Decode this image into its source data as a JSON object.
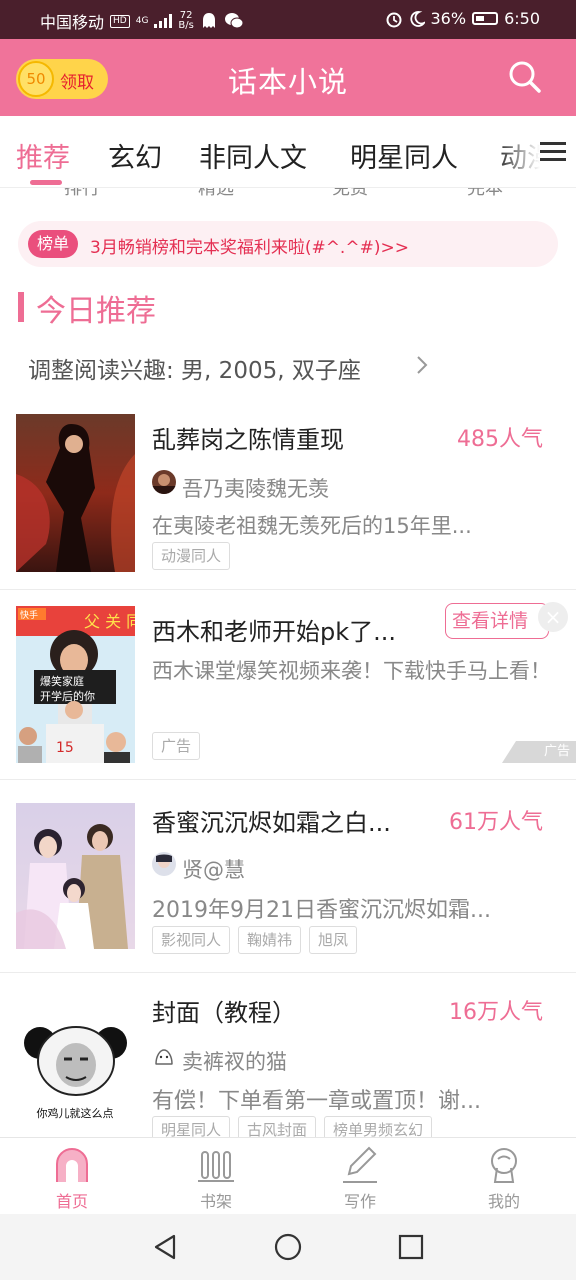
{
  "status_bar": {
    "carrier": "中国移动",
    "hd": "HD",
    "network": "4G",
    "net_speed_value": "72",
    "net_speed_unit": "B/s",
    "battery": "36%",
    "time": "6:50"
  },
  "header": {
    "coin_amount": "50",
    "coin_label": "领取",
    "title": "话本小说",
    "search_icon": "search-icon",
    "brand_color": "#f0739a"
  },
  "tabs": [
    {
      "label": "推荐",
      "active": true
    },
    {
      "label": "玄幻",
      "active": false
    },
    {
      "label": "非同人文",
      "active": false
    },
    {
      "label": "明星同人",
      "active": false
    },
    {
      "label": "动漫",
      "active": false
    }
  ],
  "quick_links": [
    "排行",
    "精选",
    "免费",
    "完本"
  ],
  "notice": {
    "badge": "榜单",
    "text": "3月畅销榜和完本奖福利来啦(#^.^#)>>"
  },
  "section": {
    "title": "今日推荐",
    "interest": "调整阅读兴趣: 男, 2005, 双子座"
  },
  "items": [
    {
      "title": "乱葬岗之陈情重现",
      "popularity": "485人气",
      "author": "吾乃夷陵魏无羡",
      "description": "在夷陵老祖魏无羡死后的15年里...",
      "tags": [
        "动漫同人"
      ]
    },
    {
      "title": "西木和老师开始pk了...",
      "ad_button": "查看详情",
      "description": "西木课堂爆笑视频来袭！下载快手马上看！",
      "tags": [
        "广告"
      ],
      "ad_corner": "广告",
      "cover_brand": "快手",
      "cover_caption": "爆笑家庭 开学后的你",
      "cover_top_text": "父 关 同",
      "cover_jersey": "15"
    },
    {
      "title": "香蜜沉沉烬如霜之白...",
      "popularity": "61万人气",
      "author": "贤@慧",
      "description": "2019年9月21日香蜜沉沉烬如霜...",
      "tags": [
        "影视同人",
        "鞠婧祎",
        "旭凤"
      ]
    },
    {
      "title": "封面（教程）",
      "popularity": "16万人气",
      "author": "卖裤衩的猫",
      "description": "有偿！下单看第一章或置顶！谢...",
      "tags": [
        "明星同人",
        "古风封面",
        "榜单男频玄幻"
      ],
      "cover_caption": "你鸡儿就这么点"
    }
  ],
  "bottom_nav": [
    {
      "label": "首页",
      "icon": "home-icon",
      "active": true
    },
    {
      "label": "书架",
      "icon": "bookshelf-icon",
      "active": false
    },
    {
      "label": "写作",
      "icon": "pen-icon",
      "active": false
    },
    {
      "label": "我的",
      "icon": "profile-icon",
      "active": false
    }
  ],
  "system_nav": [
    "back-icon",
    "home-circle-icon",
    "recents-icon"
  ]
}
